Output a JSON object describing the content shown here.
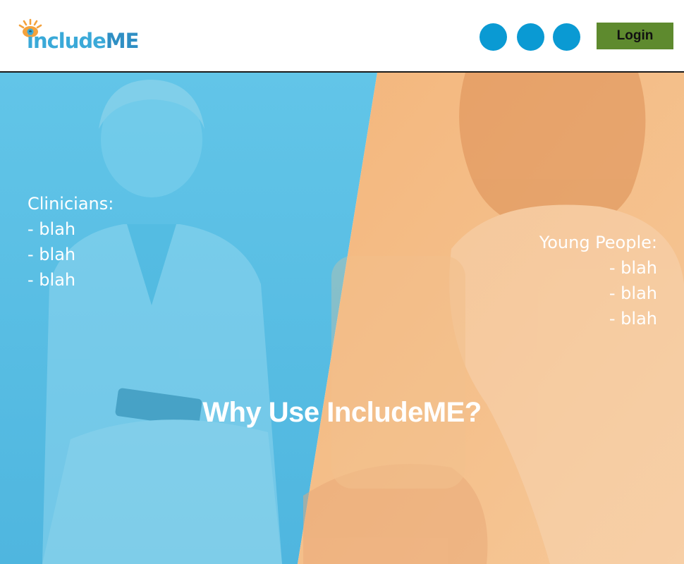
{
  "header": {
    "logo": {
      "part1": "include",
      "part2": "ME"
    },
    "social_icons": [
      "circle-icon",
      "circle-icon",
      "circle-icon"
    ],
    "login_label": "Login"
  },
  "hero": {
    "clinicians": {
      "heading": "Clinicians:",
      "items": [
        "- blah",
        "- blah",
        "- blah"
      ]
    },
    "young_people": {
      "heading": "Young People:",
      "items": [
        "- blah",
        "- blah",
        "- blah"
      ]
    },
    "headline": "Why Use IncludeME?"
  },
  "colors": {
    "clinician_overlay": "#5cc3e6",
    "young_overlay": "#f5b87a",
    "social_blue": "#0a9ad3",
    "login_green": "#5e8a2e",
    "logo_blue": "#3aa9d8",
    "logo_eye_orange": "#f4a23c"
  }
}
